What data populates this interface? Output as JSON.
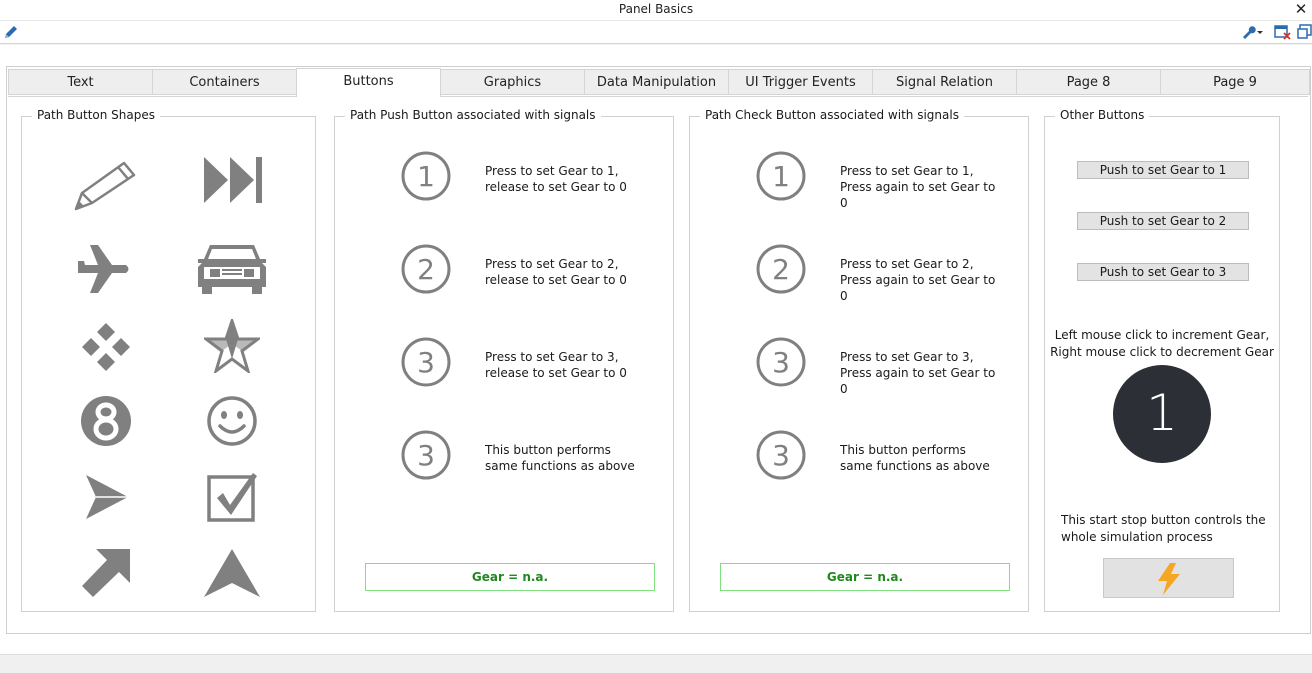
{
  "window": {
    "title": "Panel Basics",
    "close_label": "✕"
  },
  "toolbar": {
    "icons": [
      "pencil-icon",
      "wrench-icon",
      "window-close-icon",
      "window-undock-icon"
    ]
  },
  "tabs": [
    {
      "label": "Text",
      "active": false
    },
    {
      "label": "Containers",
      "active": false
    },
    {
      "label": "Buttons",
      "active": true
    },
    {
      "label": "Graphics",
      "active": false
    },
    {
      "label": "Data Manipulation",
      "active": false
    },
    {
      "label": "UI Trigger Events",
      "active": false
    },
    {
      "label": "Signal Relation",
      "active": false
    },
    {
      "label": "Page 8",
      "active": false
    },
    {
      "label": "Page 9",
      "active": false
    }
  ],
  "shapes_group": {
    "title": "Path Button Shapes",
    "shapes": [
      "pencil-icon",
      "fast-forward-icon",
      "airplane-icon",
      "car-icon",
      "diamond-cluster-icon",
      "star-icon",
      "number-8-icon",
      "smiley-icon",
      "paper-plane-icon",
      "checkbox-icon",
      "arrow-up-right-icon",
      "navigation-arrow-icon"
    ]
  },
  "push_group": {
    "title": "Path Push Button associated with signals",
    "rows": [
      {
        "symbol": "①",
        "text": "Press to set Gear to 1, release to set Gear to 0"
      },
      {
        "symbol": "②",
        "text": "Press to set Gear to 2, release to set Gear to 0"
      },
      {
        "symbol": "③",
        "text": "Press to set Gear to 3, release to set Gear to 0"
      },
      {
        "symbol": "③",
        "text": "This button performs same functions as above"
      }
    ],
    "status": "Gear = n.a."
  },
  "check_group": {
    "title": "Path Check Button associated with signals",
    "rows": [
      {
        "symbol": "①",
        "text": "Press to set Gear to 1, Press again to set Gear to 0"
      },
      {
        "symbol": "②",
        "text": "Press to set Gear to 2, Press again to set Gear to 0"
      },
      {
        "symbol": "③",
        "text": "Press to set Gear to 3, Press again to set Gear to 0"
      },
      {
        "symbol": "③",
        "text": "This button performs same functions as above"
      }
    ],
    "status": "Gear = n.a."
  },
  "other_group": {
    "title": "Other Buttons",
    "buttons": [
      "Push to set Gear to 1",
      "Push to set Gear to 2",
      "Push to set Gear to 3"
    ],
    "mouse_note_1": "Left mouse click to increment Gear,",
    "mouse_note_2": "Right mouse click to decrement Gear",
    "gear_value": "1",
    "startstop_note_1": "This start stop button controls the",
    "startstop_note_2": "whole simulation process"
  },
  "colors": {
    "icon_gray": "#808080",
    "status_green": "#1e8a1e",
    "status_border": "#7fe07f",
    "gear_circle": "#2c2f35",
    "lightning": "#f5a623",
    "toolbar_blue": "#2b6cb0"
  }
}
